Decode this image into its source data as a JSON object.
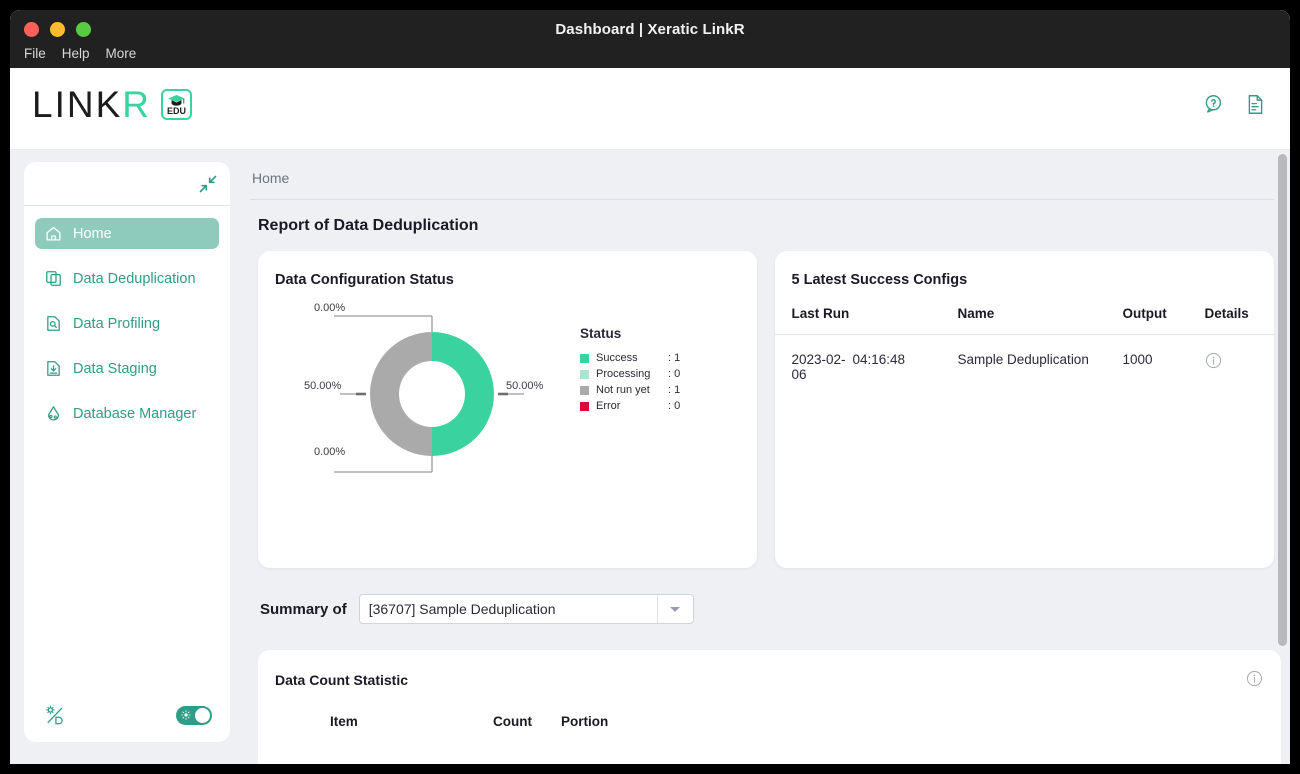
{
  "window": {
    "title": "Dashboard | Xeratic LinkR",
    "menu": [
      "File",
      "Help",
      "More"
    ],
    "controls": [
      "close",
      "minimize",
      "maximize"
    ]
  },
  "header": {
    "logo_main": "LINK",
    "logo_accent": "R",
    "edu_badge": "EDU",
    "icons": [
      {
        "name": "help-icon"
      },
      {
        "name": "document-icon"
      }
    ]
  },
  "sidebar": {
    "collapse_icon": "collapse-icon",
    "items": [
      {
        "label": "Home",
        "icon": "home-icon",
        "active": true
      },
      {
        "label": "Data Deduplication",
        "icon": "copy-icon",
        "active": false
      },
      {
        "label": "Data Profiling",
        "icon": "file-search-icon",
        "active": false
      },
      {
        "label": "Data Staging",
        "icon": "file-import-icon",
        "active": false
      },
      {
        "label": "Database Manager",
        "icon": "database-icon",
        "active": false
      }
    ],
    "theme_icon": "theme-toggle-icon",
    "theme_toggle_on": true
  },
  "main": {
    "breadcrumb": "Home",
    "page_title": "Report of Data Deduplication",
    "status_card": {
      "title": "Data Configuration Status"
    },
    "configs_card": {
      "title": "5 Latest Success Configs",
      "columns": [
        "Last Run",
        "",
        "Name",
        "Output",
        "Details"
      ],
      "rows": [
        {
          "date": "2023-02-06",
          "time": "04:16:48",
          "name": "Sample Deduplication",
          "output": "1000",
          "details_icon": "info-icon"
        }
      ]
    },
    "summary": {
      "label": "Summary of",
      "selected": "[36707] Sample Deduplication",
      "options": [
        "[36707] Sample Deduplication"
      ]
    },
    "statistic_card": {
      "title": "Data Count Statistic",
      "info_icon": "info-icon",
      "columns": [
        "Item",
        "Count",
        "Portion"
      ],
      "rows": []
    }
  },
  "chart_data": {
    "type": "pie",
    "title": "Data Configuration Status",
    "legend_title": "Status",
    "legend_position": "right",
    "donut": true,
    "categories": [
      "Success",
      "Processing",
      "Not run yet",
      "Error"
    ],
    "values": [
      1,
      0,
      1,
      0
    ],
    "percentages": [
      "50.00%",
      "0.00%",
      "50.00%",
      "0.00%"
    ],
    "colors": [
      "#3ad29f",
      "#a9e6d0",
      "#aaaaaa",
      "#d0103a"
    ],
    "labels": [
      {
        "text": "0.00%",
        "position": "top-left"
      },
      {
        "text": "50.00%",
        "position": "right"
      },
      {
        "text": "50.00%",
        "position": "left"
      },
      {
        "text": "0.00%",
        "position": "bottom-left"
      }
    ]
  },
  "colors": {
    "accent": "#3ad29f",
    "accent_dark": "#2f9c87",
    "active_nav": "#8fcbbc",
    "body_bg": "#eef0f4",
    "titlebar": "#212121",
    "gray_segment": "#aaaaaa",
    "error": "#d0103a"
  }
}
